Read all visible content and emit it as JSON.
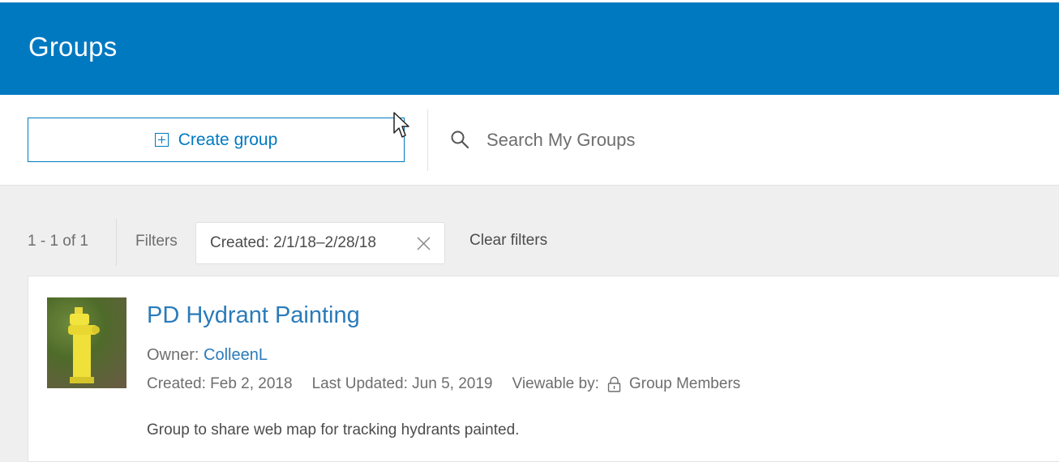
{
  "header": {
    "title": "Groups",
    "color": "#0079c1"
  },
  "toolbar": {
    "create_label": "Create group",
    "search_placeholder": "Search My Groups",
    "search_value": ""
  },
  "filter_bar": {
    "count": "1 - 1 of 1",
    "filters_label": "Filters",
    "chip_label": "Created: 2/1/18–2/28/18",
    "clear_label": "Clear filters"
  },
  "groups": [
    {
      "title": "PD Hydrant Painting",
      "owner_label": "Owner:",
      "owner": "ColleenL",
      "created_label": "Created:",
      "created": "Feb 2, 2018",
      "updated_label": "Last Updated:",
      "updated": "Jun 5, 2019",
      "viewable_label": "Viewable by:",
      "viewable": "Group Members",
      "description": "Group to share web map for tracking hydrants painted."
    }
  ],
  "icons": {
    "plus": "plus-box-icon",
    "search": "search-icon",
    "close": "close-icon",
    "lock": "lock-icon",
    "cursor": "mouse-cursor-icon"
  },
  "colors": {
    "accent": "#0079c1",
    "link": "#2b7bb9"
  }
}
